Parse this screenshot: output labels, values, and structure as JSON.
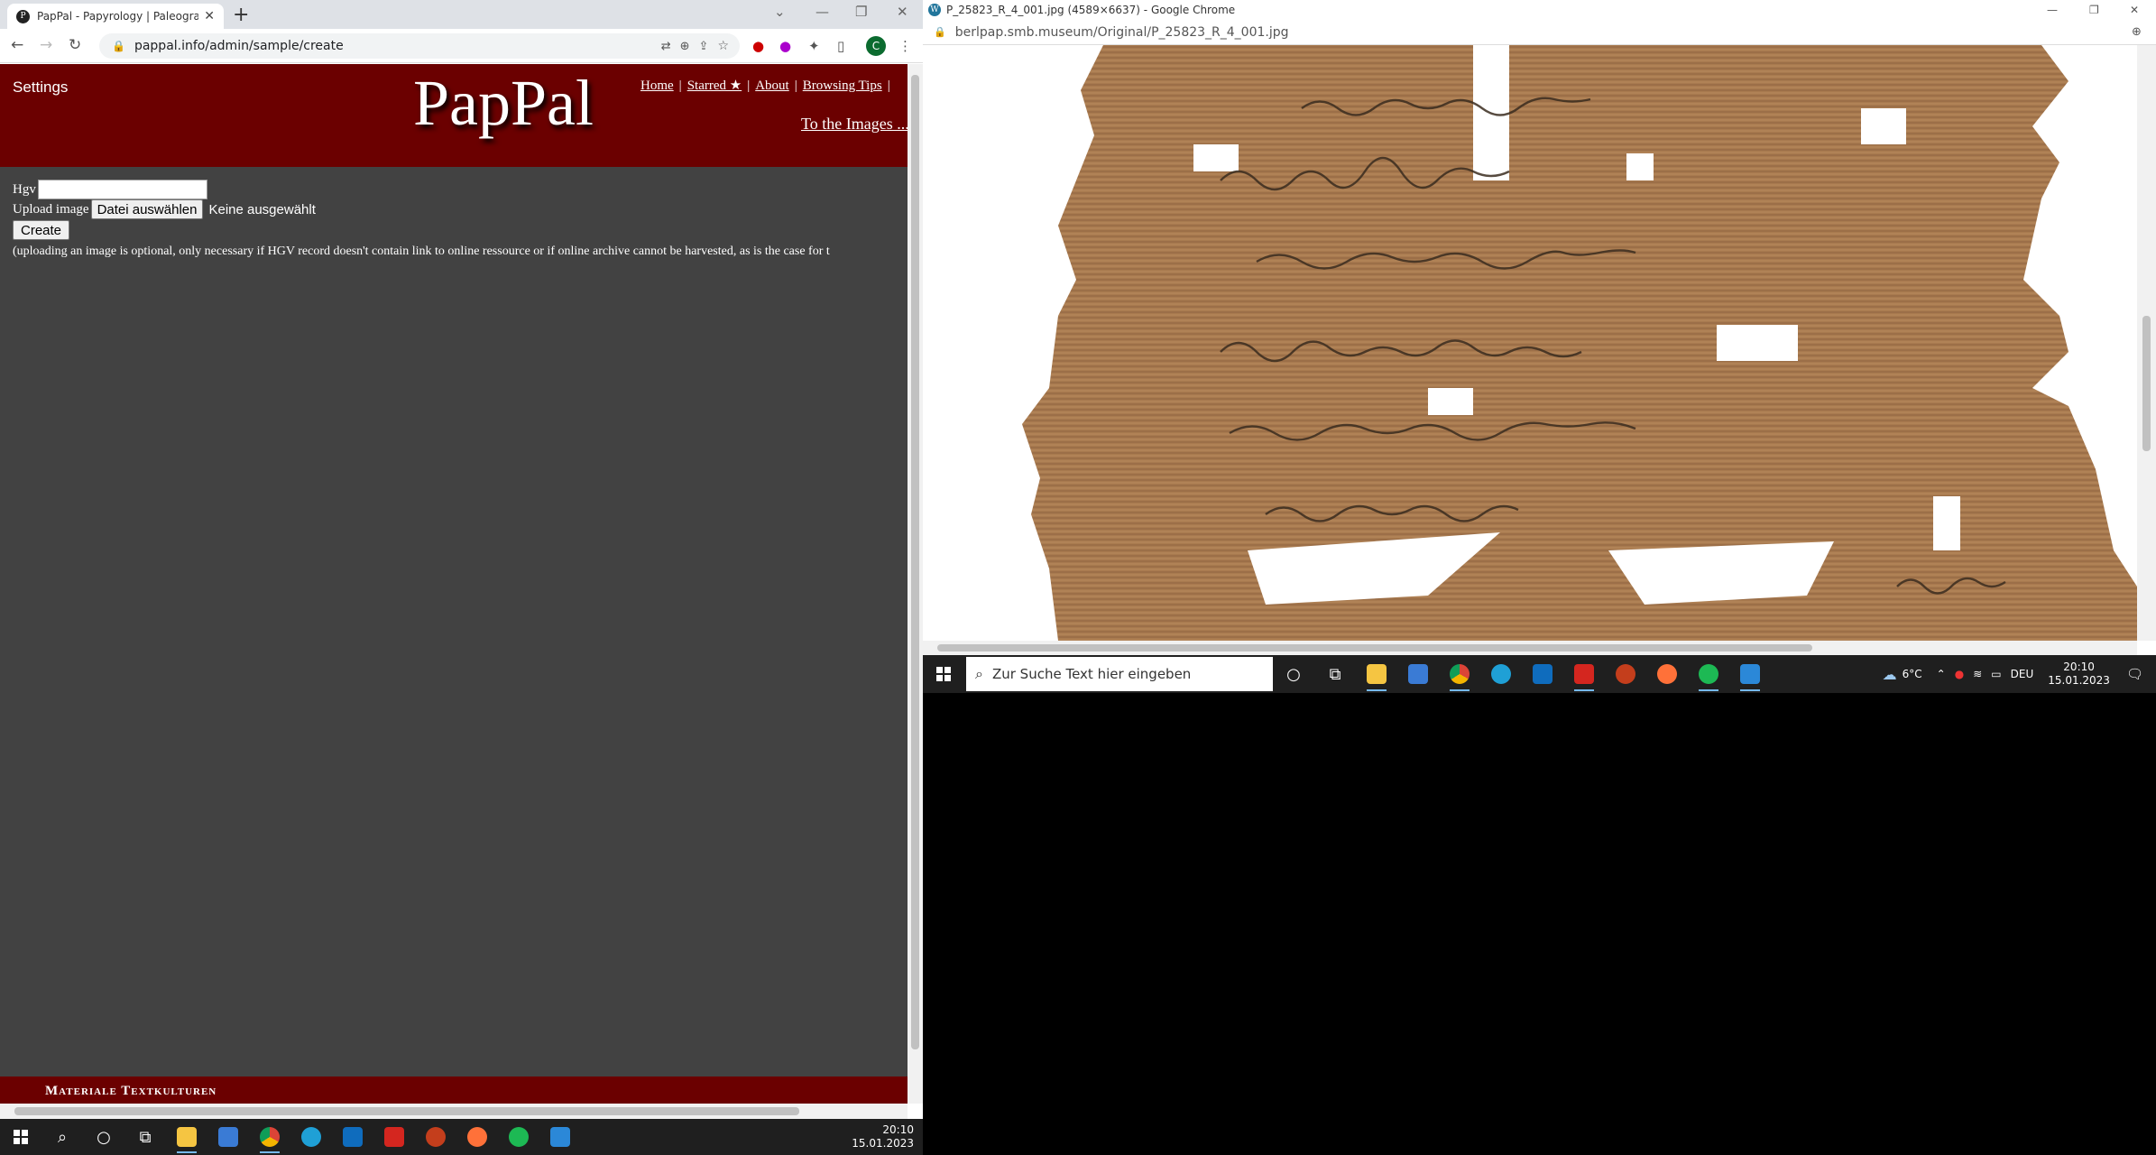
{
  "left_window": {
    "tab_title": "PapPal - Papyrology | Paleograph",
    "tab_favicon": "P",
    "url": "pappal.info/admin/sample/create"
  },
  "pappal": {
    "settings": "Settings",
    "logo": "PapPal",
    "nav": [
      "Home",
      "Starred ★",
      "About",
      "Browsing Tips"
    ],
    "to_images": "To the Images ...",
    "form": {
      "hgv_label": "Hgv",
      "hgv_value": "",
      "upload_label": "Upload image",
      "file_button": "Datei auswählen",
      "file_status": "Keine ausgewählt",
      "create_button": "Create",
      "note": "(uploading an image is optional, only necessary if HGV record doesn't contain link to online ressource or if online archive cannot be harvested, as is the case for t"
    },
    "footer": "Materiale Textkulturen"
  },
  "right_window": {
    "title": "P_25823_R_4_001.jpg (4589×6637) - Google Chrome",
    "url": "berlpap.smb.museum/Original/P_25823_R_4_001.jpg"
  },
  "taskbar_right": {
    "search_placeholder": "Zur Suche Text hier eingeben",
    "weather": "6°C",
    "lang": "DEU",
    "time": "20:10",
    "date": "15.01.2023"
  },
  "taskbar_left": {
    "time": "20:10",
    "date": "15.01.2023"
  },
  "colors": {
    "pappal_red": "#6b0000",
    "page_bg": "#424242",
    "papyrus": "#a87a4f"
  }
}
